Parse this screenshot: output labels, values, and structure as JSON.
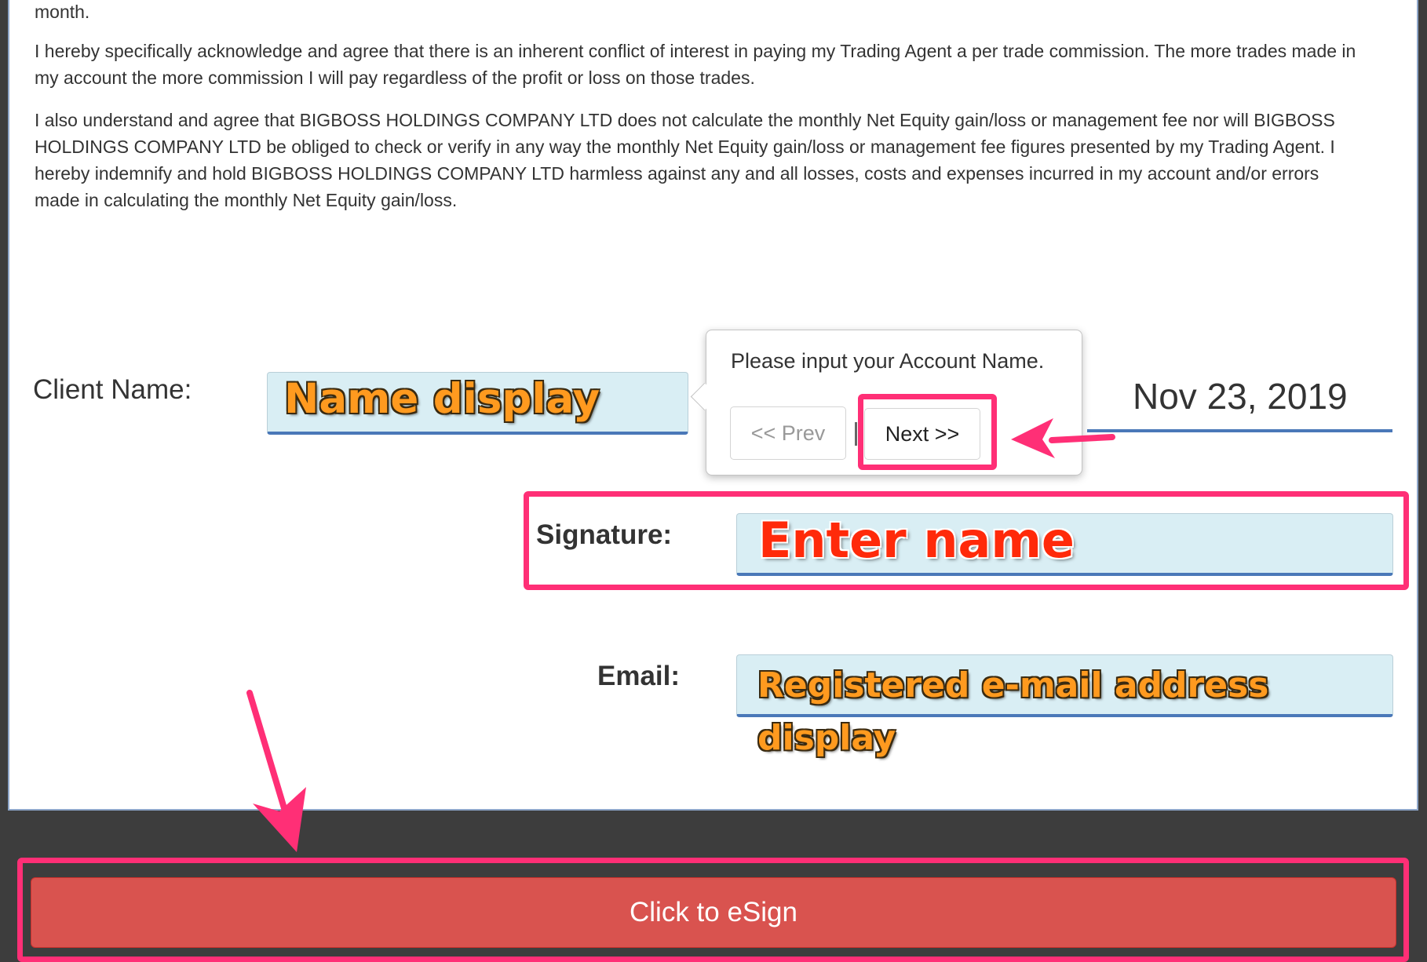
{
  "document": {
    "paragraphs": [
      "month.",
      "I hereby specifically acknowledge and agree that there is an inherent conflict of interest in paying my Trading Agent a per trade commission. The more trades made in my account the more commission I will pay regardless of the profit or loss on those trades.",
      "I also understand and agree that BIGBOSS HOLDINGS COMPANY LTD does not calculate the monthly Net Equity gain/loss or management fee nor will BIGBOSS HOLDINGS COMPANY LTD be obliged to check or verify in any way the monthly Net Equity gain/loss or management fee figures presented by my Trading Agent. I hereby indemnify and hold BIGBOSS HOLDINGS COMPANY LTD harmless against any and all losses, costs and expenses incurred in my account and/or errors made in calculating the monthly Net Equity gain/loss."
    ]
  },
  "form": {
    "client_name_label": "Client Name:",
    "date": "Nov 23, 2019",
    "signature_label": "Signature:",
    "email_label": "Email:"
  },
  "popover": {
    "message": "Please input your Account Name.",
    "prev_label": "<< Prev",
    "next_label": "Next >>"
  },
  "annotations": {
    "name_display": "Name display",
    "enter_name": "Enter name",
    "email_display_line1": "Registered e-mail address",
    "email_display_line2": "display"
  },
  "footer": {
    "esign_label": "Click to eSign"
  },
  "colors": {
    "highlight": "#ff2f76",
    "esign_button": "#d9534f",
    "input_background": "#d9eef4",
    "input_underline": "#4a78b8",
    "annotation_orange": "#ff9a1f",
    "annotation_red": "#ff2a0a"
  },
  "icons": [
    "arrow-to-next-button-icon",
    "arrow-to-esign-button-icon"
  ]
}
